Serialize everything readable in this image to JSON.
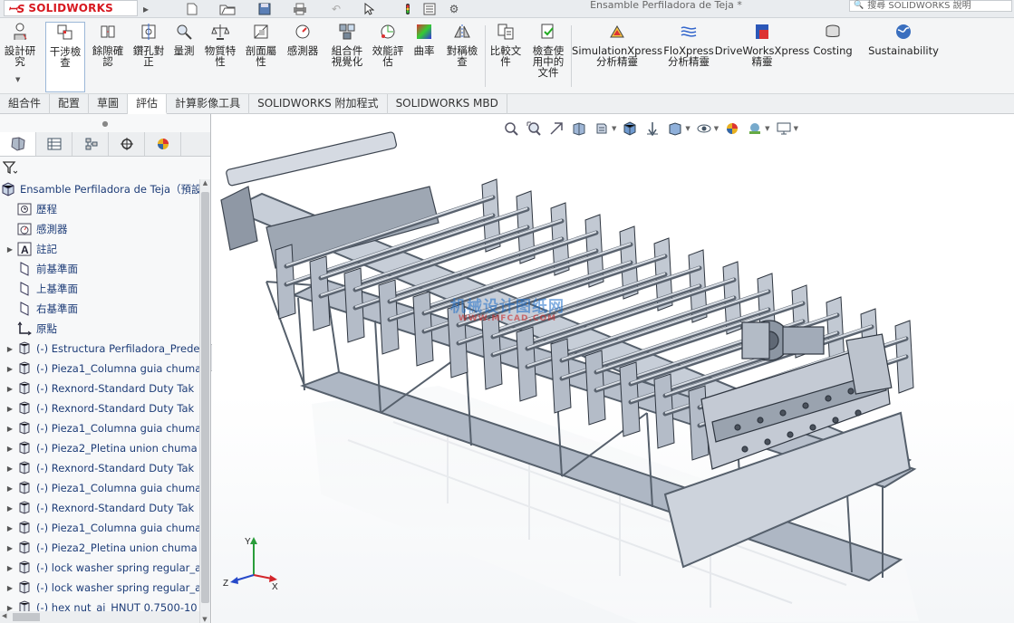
{
  "titlebar": {
    "brand": "SOLIDWORKS",
    "document_title": "Ensamble Perfiladora de Teja *",
    "help_search_placeholder": "搜尋 SOLIDWORKS 說明"
  },
  "ribbon": {
    "buttons": [
      {
        "label": "設計研\n究",
        "icon": "design-study-icon"
      },
      {
        "label": "干涉檢\n查",
        "icon": "interference-check-icon",
        "active": true
      },
      {
        "label": "餘隙確\n認",
        "icon": "clearance-icon"
      },
      {
        "label": "鑽孔對\n正",
        "icon": "hole-alignment-icon"
      },
      {
        "label": "量測",
        "icon": "measure-icon"
      },
      {
        "label": "物質特\n性",
        "icon": "mass-properties-icon"
      },
      {
        "label": "剖面屬\n性",
        "icon": "section-properties-icon"
      },
      {
        "label": "感測器",
        "icon": "sensor-icon"
      },
      {
        "label": "組合件\n視覺化",
        "icon": "assembly-visualization-icon"
      },
      {
        "label": "效能評\n估",
        "icon": "performance-evaluation-icon"
      },
      {
        "label": "曲率",
        "icon": "curvature-icon"
      },
      {
        "label": "對稱檢\n查",
        "icon": "symmetry-check-icon"
      },
      {
        "label": "比較文\n件",
        "icon": "compare-documents-icon"
      },
      {
        "label": "檢查使\n用中的\n文件",
        "icon": "check-active-document-icon"
      },
      {
        "label": "SimulationXpress\n分析精靈",
        "icon": "simulationxpress-icon"
      },
      {
        "label": "FloXpress\n分析精靈",
        "icon": "floxpress-icon"
      },
      {
        "label": "DriveWorksXpress\n精靈",
        "icon": "driveworksxpress-icon"
      },
      {
        "label": "Costing",
        "icon": "costing-icon"
      },
      {
        "label": "Sustainability",
        "icon": "sustainability-icon"
      }
    ]
  },
  "command_tabs": [
    {
      "label": "組合件"
    },
    {
      "label": "配置"
    },
    {
      "label": "草圖"
    },
    {
      "label": "評估",
      "active": true
    },
    {
      "label": "計算影像工具"
    },
    {
      "label": "SOLIDWORKS 附加程式"
    },
    {
      "label": "SOLIDWORKS MBD"
    }
  ],
  "feature_tree": {
    "root": "Ensamble Perfiladora de Teja（預設",
    "items": [
      {
        "label": "歷程",
        "icon": "history-icon",
        "expandable": false
      },
      {
        "label": "感測器",
        "icon": "sensors-icon",
        "expandable": false
      },
      {
        "label": "註記",
        "icon": "annotations-icon",
        "expandable": true
      },
      {
        "label": "前基準面",
        "icon": "plane-icon",
        "expandable": false
      },
      {
        "label": "上基準面",
        "icon": "plane-icon",
        "expandable": false
      },
      {
        "label": "右基準面",
        "icon": "plane-icon",
        "expandable": false
      },
      {
        "label": "原點",
        "icon": "origin-icon",
        "expandable": false
      },
      {
        "label": "(-) Estructura Perfiladora_Prede",
        "icon": "part-icon",
        "expandable": true
      },
      {
        "label": "(-) Pieza1_Columna guia chuma",
        "icon": "part-icon",
        "expandable": true
      },
      {
        "label": "(-) Rexnord-Standard Duty Tak",
        "icon": "part-icon",
        "expandable": true
      },
      {
        "label": "(-) Rexnord-Standard Duty Tak",
        "icon": "part-icon",
        "expandable": true
      },
      {
        "label": "(-) Pieza1_Columna guia chuma",
        "icon": "part-icon",
        "expandable": true
      },
      {
        "label": "(-) Pieza2_Pletina union chuma",
        "icon": "part-icon",
        "expandable": true
      },
      {
        "label": "(-) Rexnord-Standard Duty Tak",
        "icon": "part-icon",
        "expandable": true
      },
      {
        "label": "(-) Pieza1_Columna guia chuma",
        "icon": "part-icon",
        "expandable": true
      },
      {
        "label": "(-) Rexnord-Standard Duty Tak",
        "icon": "part-icon",
        "expandable": true
      },
      {
        "label": "(-) Pieza1_Columna guia chuma",
        "icon": "part-icon",
        "expandable": true
      },
      {
        "label": "(-) Pieza2_Pletina union chuma",
        "icon": "part-icon",
        "expandable": true
      },
      {
        "label": "(-) lock washer spring regular_a",
        "icon": "part-icon",
        "expandable": true
      },
      {
        "label": "(-) lock washer spring regular_a",
        "icon": "part-icon",
        "expandable": true
      },
      {
        "label": "(-) hex nut_ai_HNUT 0.7500-10",
        "icon": "part-icon",
        "expandable": true
      }
    ]
  },
  "viewport": {
    "watermark_line1": "机械设计图纸网",
    "watermark_line2": "WWW.MFCAD.COM",
    "triad": {
      "x": "X",
      "y": "Y",
      "z": "Z"
    }
  },
  "colors": {
    "brand_red": "#d71920",
    "selection_blue": "#9cb8d8",
    "tree_text": "#1e3d78",
    "model_steel": "#9aa4b2"
  }
}
